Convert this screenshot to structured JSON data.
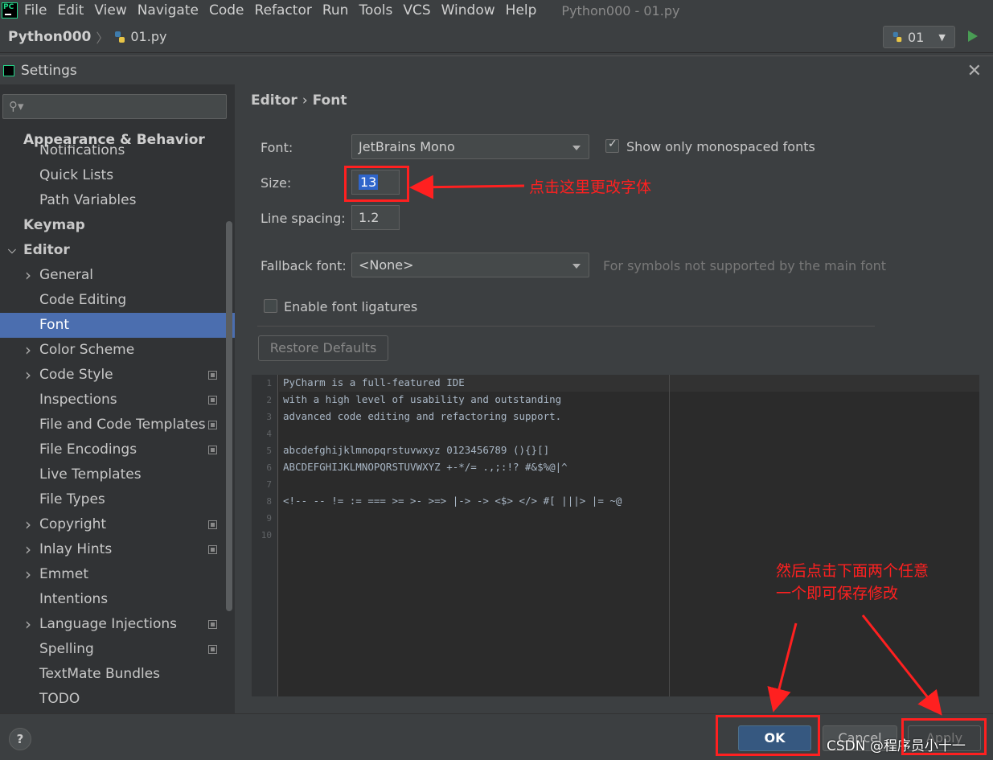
{
  "menubar": {
    "items": [
      "File",
      "Edit",
      "View",
      "Navigate",
      "Code",
      "Refactor",
      "Run",
      "Tools",
      "VCS",
      "Window",
      "Help"
    ],
    "window_title": "Python000 - 01.py"
  },
  "navbar": {
    "project": "Python000",
    "file": "01.py",
    "run_config": "01"
  },
  "dialog": {
    "title": "Settings"
  },
  "sidebar": {
    "header_overlap": "Appearance & Behavior",
    "clipped_item": "Notifications",
    "items": [
      {
        "label": "Quick Lists",
        "level": 1,
        "arrow": false,
        "proj": false
      },
      {
        "label": "Path Variables",
        "level": 1,
        "arrow": false,
        "proj": false
      },
      {
        "label": "Keymap",
        "level": 0,
        "arrow": false,
        "proj": false
      },
      {
        "label": "Editor",
        "level": 0,
        "arrow": "down",
        "proj": false
      },
      {
        "label": "General",
        "level": 1,
        "arrow": "right",
        "proj": false
      },
      {
        "label": "Code Editing",
        "level": 1,
        "arrow": false,
        "proj": false
      },
      {
        "label": "Font",
        "level": 1,
        "arrow": false,
        "proj": false,
        "selected": true
      },
      {
        "label": "Color Scheme",
        "level": 1,
        "arrow": "right",
        "proj": false
      },
      {
        "label": "Code Style",
        "level": 1,
        "arrow": "right",
        "proj": true
      },
      {
        "label": "Inspections",
        "level": 1,
        "arrow": false,
        "proj": true
      },
      {
        "label": "File and Code Templates",
        "level": 1,
        "arrow": false,
        "proj": true
      },
      {
        "label": "File Encodings",
        "level": 1,
        "arrow": false,
        "proj": true
      },
      {
        "label": "Live Templates",
        "level": 1,
        "arrow": false,
        "proj": false
      },
      {
        "label": "File Types",
        "level": 1,
        "arrow": false,
        "proj": false
      },
      {
        "label": "Copyright",
        "level": 1,
        "arrow": "right",
        "proj": true
      },
      {
        "label": "Inlay Hints",
        "level": 1,
        "arrow": "right",
        "proj": true
      },
      {
        "label": "Emmet",
        "level": 1,
        "arrow": "right",
        "proj": false
      },
      {
        "label": "Intentions",
        "level": 1,
        "arrow": false,
        "proj": false
      },
      {
        "label": "Language Injections",
        "level": 1,
        "arrow": "right",
        "proj": true
      },
      {
        "label": "Spelling",
        "level": 1,
        "arrow": false,
        "proj": true
      },
      {
        "label": "TextMate Bundles",
        "level": 1,
        "arrow": false,
        "proj": false
      },
      {
        "label": "TODO",
        "level": 1,
        "arrow": false,
        "proj": false
      }
    ]
  },
  "content": {
    "breadcrumb_parent": "Editor",
    "breadcrumb_sep": "›",
    "breadcrumb_current": "Font",
    "font_label": "Font:",
    "font_value": "JetBrains Mono",
    "mono_only_label": "Show only monospaced fonts",
    "mono_only_checked": true,
    "size_label": "Size:",
    "size_value": "13",
    "line_spacing_label": "Line spacing:",
    "line_spacing_value": "1.2",
    "fallback_label": "Fallback font:",
    "fallback_value": "<None>",
    "fallback_hint": "For symbols not supported by the main font",
    "ligatures_label": "Enable font ligatures",
    "ligatures_checked": false,
    "restore_label": "Restore Defaults"
  },
  "preview": {
    "lines": [
      "PyCharm is a full-featured IDE",
      "with a high level of usability and outstanding",
      "advanced code editing and refactoring support.",
      "",
      "abcdefghijklmnopqrstuvwxyz 0123456789 (){}[]",
      "ABCDEFGHIJKLMNOPQRSTUVWXYZ +-*/= .,;:!? #&$%@|^",
      "",
      "<!-- -- != := === >= >- >=> |-> -> <$> </> #[ |||> |= ~@",
      "",
      ""
    ]
  },
  "buttons": {
    "help": "?",
    "ok": "OK",
    "cancel": "Cancel",
    "apply": "Apply"
  },
  "annotations": {
    "size_note": "点击这里更改字体",
    "save_note_line1": "然后点击下面两个任意",
    "save_note_line2": "一个即可保存修改",
    "color": "#ff2020"
  },
  "watermark": "CSDN @程序员小十一"
}
